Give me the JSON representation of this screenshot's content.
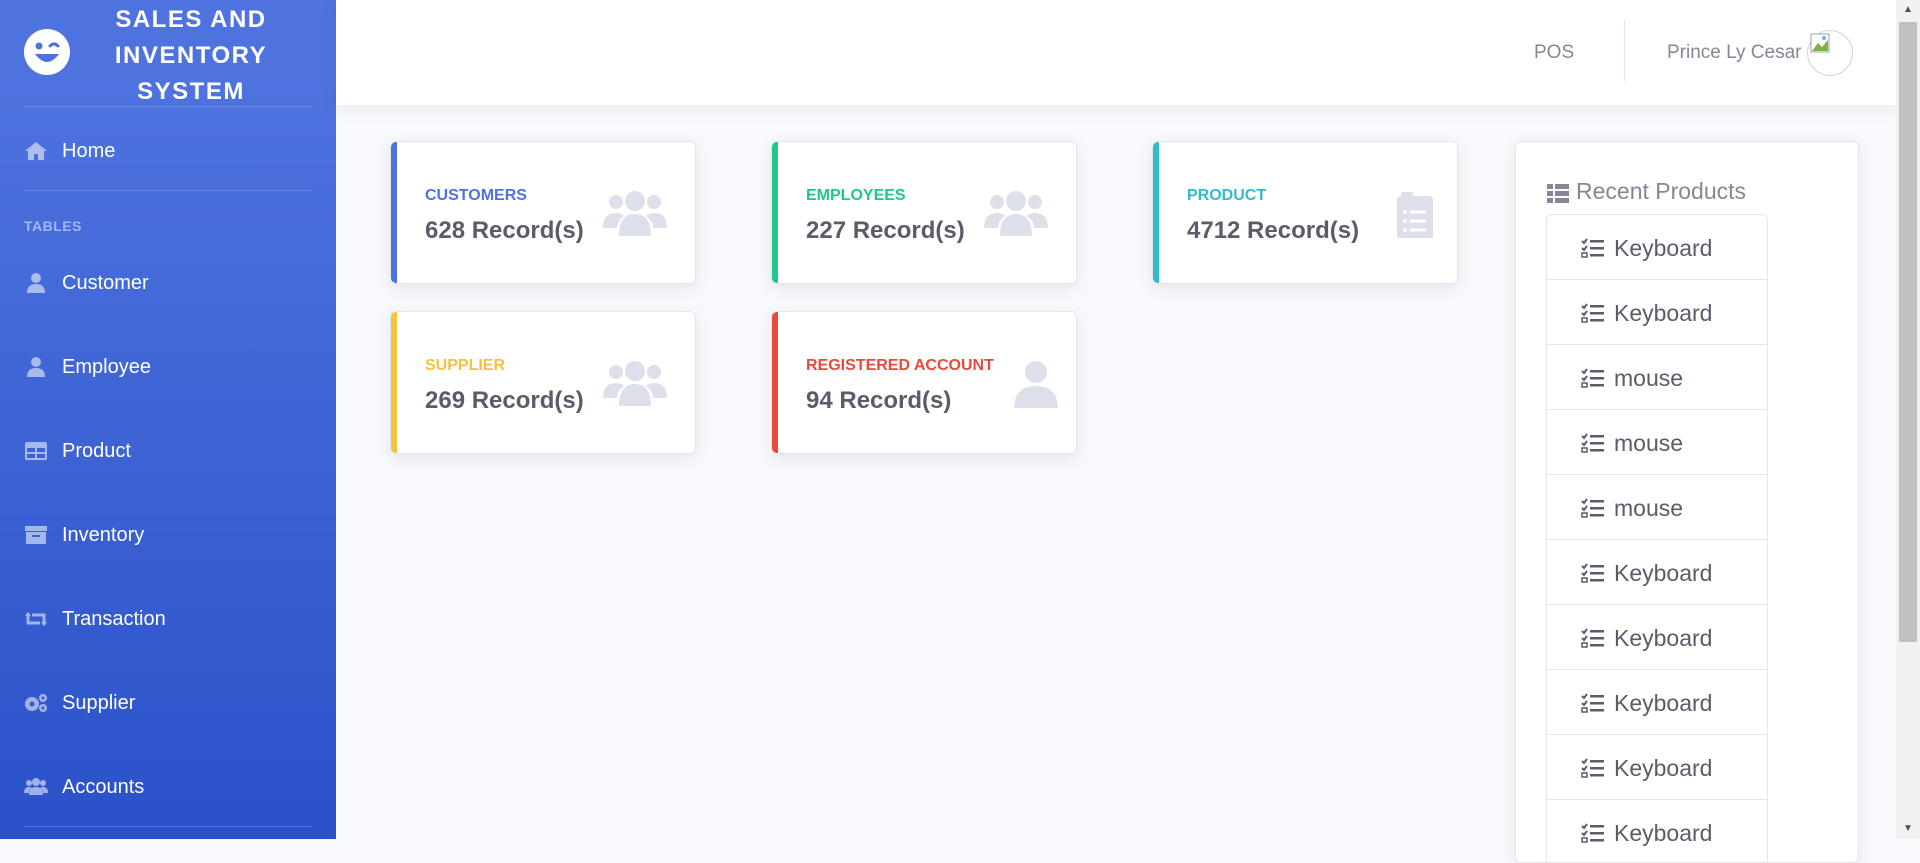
{
  "brand": {
    "title": "SALES AND INVENTORY SYSTEM"
  },
  "sidebar": {
    "items": [
      {
        "label": "Home",
        "icon": "home-icon"
      },
      {
        "label": "Customer",
        "icon": "user-icon"
      },
      {
        "label": "Employee",
        "icon": "user-icon"
      },
      {
        "label": "Product",
        "icon": "table-icon"
      },
      {
        "label": "Inventory",
        "icon": "archive-icon"
      },
      {
        "label": "Transaction",
        "icon": "retweet-icon"
      },
      {
        "label": "Supplier",
        "icon": "cogs-icon"
      },
      {
        "label": "Accounts",
        "icon": "users-icon"
      }
    ],
    "heading": "TABLES"
  },
  "topbar": {
    "pos_label": "POS",
    "user_name": "Prince Ly Cesar"
  },
  "cards": [
    {
      "label": "CUSTOMERS",
      "value": "628 Record(s)",
      "color": "#4e73df",
      "icon": "users-icon"
    },
    {
      "label": "EMPLOYEES",
      "value": "227 Record(s)",
      "color": "#1cc88a",
      "icon": "users-icon"
    },
    {
      "label": "PRODUCT",
      "value": "4712 Record(s)",
      "color": "#36b9cc",
      "icon": "clipboard-list-icon"
    },
    {
      "label": "SUPPLIER",
      "value": "269 Record(s)",
      "color": "#f6c23e",
      "icon": "users-icon"
    },
    {
      "label": "REGISTERED ACCOUNT",
      "value": "94 Record(s)",
      "color": "#e74a3b",
      "icon": "user-icon"
    }
  ],
  "recent_products": {
    "title": "Recent Products",
    "items": [
      "Keyboard",
      "Keyboard",
      "mouse",
      "mouse",
      "mouse",
      "Keyboard",
      "Keyboard",
      "Keyboard",
      "Keyboard",
      "Keyboard"
    ]
  },
  "colors": {
    "primary": "#4e73df",
    "text_muted": "#858796",
    "text_dark": "#5a5c69",
    "icon_muted": "#dddfeb"
  }
}
